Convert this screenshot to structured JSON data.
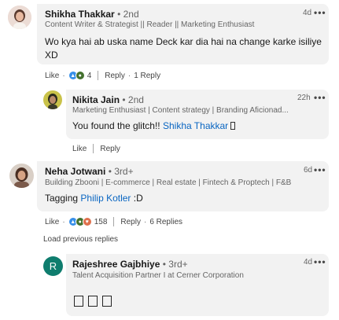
{
  "comments": [
    {
      "name": "Shikha Thakkar",
      "degree": "2nd",
      "headline": "Content Writer & Strategist || Reader || Marketing Enthusiast",
      "time": "4d",
      "text_line1": "Wo kya hai ab uska name Deck kar dia hai na change karke isiliye",
      "text_line2": "XD",
      "like_label": "Like",
      "reaction_count": "4",
      "reply_label": "Reply",
      "replies_label": "1 Reply"
    },
    {
      "name": "Nikita Jain",
      "degree": "2nd",
      "headline": "Marketing Enthusiast | Content strategy | Branding Aficionad...",
      "time": "22h",
      "text_prefix": "You found the glitch!!",
      "mention": "Shikha Thakkar",
      "like_label": "Like",
      "reply_label": "Reply"
    },
    {
      "name": "Neha Jotwani",
      "degree": "3rd+",
      "headline": "Building Zbooni | E-commerce | Real estate | Fintech & Proptech | F&B",
      "time": "6d",
      "text_prefix": "Tagging",
      "mention": "Philip Kotler",
      "text_suffix": ":D",
      "like_label": "Like",
      "reaction_count": "158",
      "reply_label": "Reply",
      "replies_label": "6 Replies"
    },
    {
      "name": "Rajeshree Gajbhiye",
      "degree": "3rd+",
      "headline": "Talent Acquisition Partner I at Cerner Corporation",
      "time": "4d",
      "avatar_initial": "R"
    }
  ],
  "load_previous": "Load previous replies",
  "degree_separator": "•",
  "action_separator": "·",
  "more_glyph": "•••",
  "colors": {
    "link": "#0a66c2",
    "bubble": "#f2f2f2",
    "avatar_r": "#0f7d6e",
    "like_reaction": "#378fe9",
    "celebrate_reaction": "#44712e",
    "love_reaction": "#df704d"
  }
}
